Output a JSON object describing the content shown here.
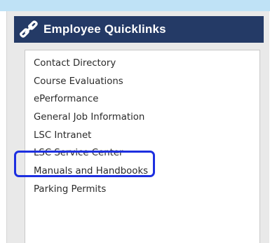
{
  "widget": {
    "title": "Employee Quicklinks",
    "icon": "link-icon"
  },
  "links": [
    {
      "label": "Contact Directory"
    },
    {
      "label": "Course Evaluations"
    },
    {
      "label": "ePerformance"
    },
    {
      "label": "General Job Information"
    },
    {
      "label": "LSC Intranet"
    },
    {
      "label": "LSC Service Center",
      "highlighted": true
    },
    {
      "label": "Manuals and Handbooks"
    },
    {
      "label": "Parking Permits"
    }
  ],
  "colors": {
    "header_bg": "#243a66",
    "panel_bg": "#e9e9e9",
    "highlight": "#1d2fe0",
    "top_strip": "#bfe2f6"
  }
}
